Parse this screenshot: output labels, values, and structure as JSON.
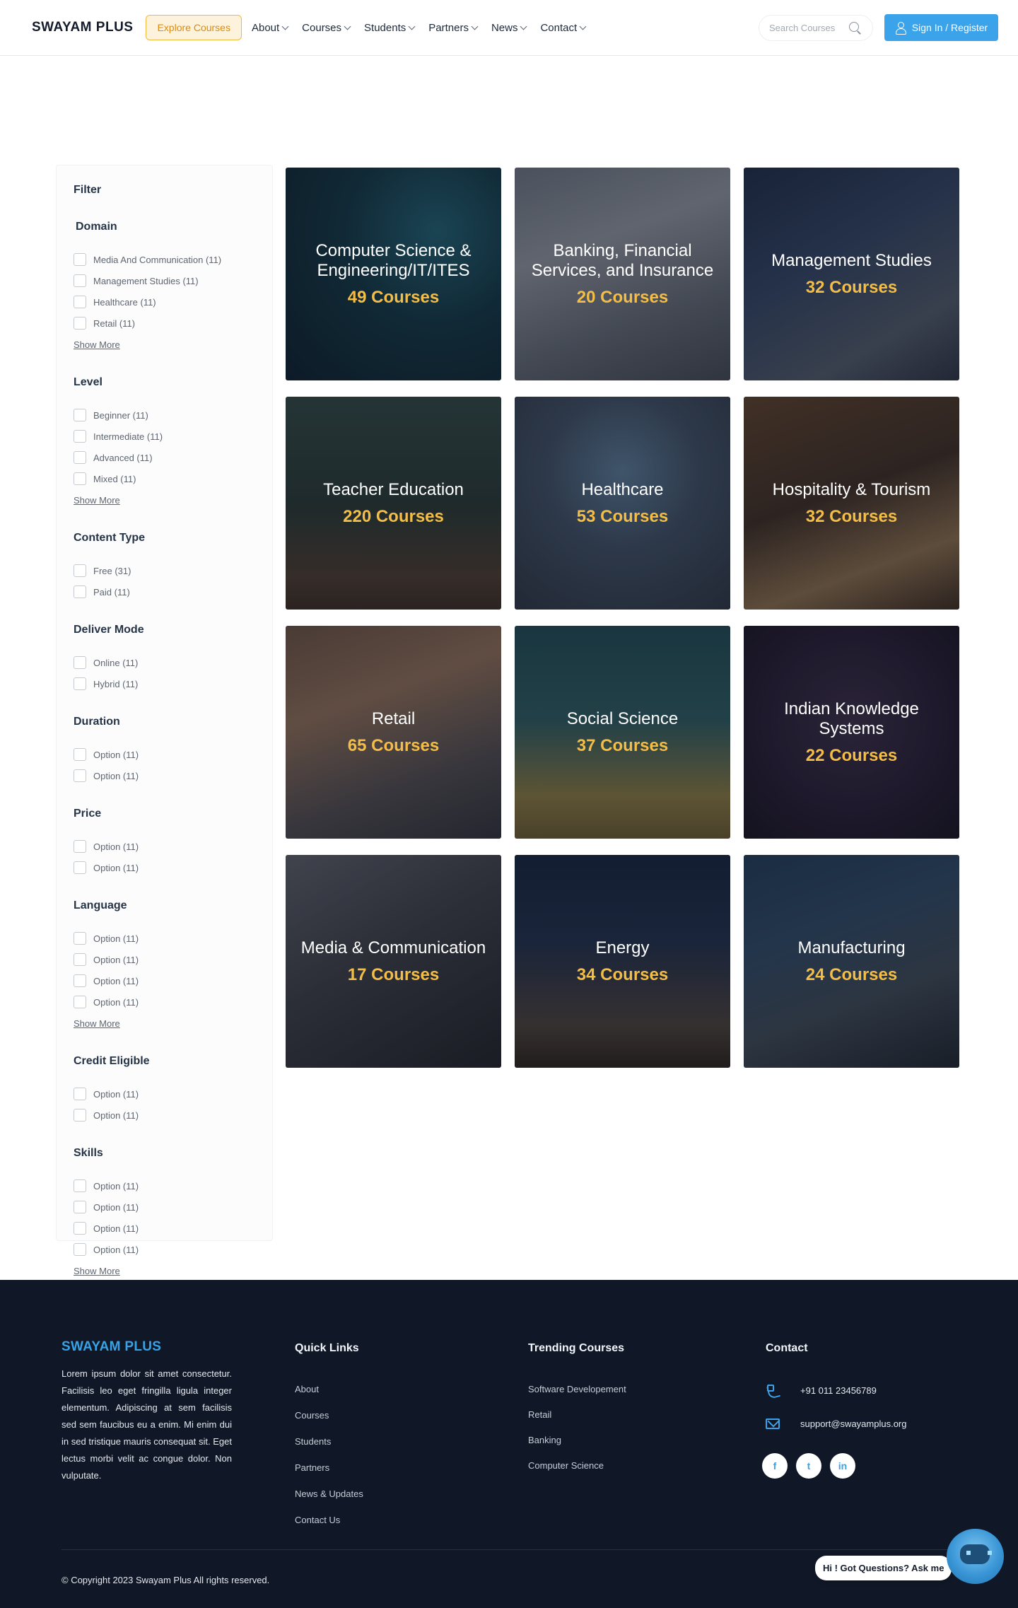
{
  "header": {
    "logo": "SWAYAM PLUS",
    "explore_label": "Explore Courses",
    "nav": [
      {
        "label": "About"
      },
      {
        "label": "Courses"
      },
      {
        "label": "Students"
      },
      {
        "label": "Partners"
      },
      {
        "label": "News"
      },
      {
        "label": "Contact"
      }
    ],
    "search_placeholder": "Search Courses",
    "signin_label": "Sign In / Register"
  },
  "filter": {
    "title": "Filter",
    "groups": [
      {
        "title": "Domain",
        "options": [
          "Media And Communication (11)",
          "Management Studies (11)",
          "Healthcare (11)",
          "Retail (11)"
        ],
        "show_more": "Show More"
      },
      {
        "title": "Level",
        "options": [
          "Beginner (11)",
          "Intermediate (11)",
          "Advanced (11)",
          "Mixed (11)"
        ],
        "show_more": "Show More"
      },
      {
        "title": "Content Type",
        "options": [
          "Free (31)",
          "Paid (11)"
        ]
      },
      {
        "title": "Deliver Mode",
        "options": [
          "Online (11)",
          "Hybrid (11)"
        ]
      },
      {
        "title": "Duration",
        "options": [
          "Option (11)",
          "Option (11)"
        ]
      },
      {
        "title": "Price",
        "options": [
          "Option (11)",
          "Option (11)"
        ]
      },
      {
        "title": "Language",
        "options": [
          "Option (11)",
          "Option (11)",
          "Option (11)",
          "Option (11)"
        ],
        "show_more": "Show More"
      },
      {
        "title": "Credit Eligible",
        "options": [
          "Option (11)",
          "Option (11)"
        ]
      },
      {
        "title": "Skills",
        "options": [
          "Option (11)",
          "Option (11)",
          "Option (11)",
          "Option (11)"
        ],
        "show_more": "Show More"
      }
    ]
  },
  "categories": [
    {
      "title": "Computer Science & Engineering/IT/ITES",
      "count": "49 Courses"
    },
    {
      "title": "Banking, Financial Services, and Insurance",
      "count": "20 Courses"
    },
    {
      "title": "Management Studies",
      "count": "32 Courses"
    },
    {
      "title": "Teacher  Education",
      "count": "220 Courses"
    },
    {
      "title": "Healthcare",
      "count": "53 Courses"
    },
    {
      "title": "Hospitality & Tourism",
      "count": "32 Courses"
    },
    {
      "title": "Retail",
      "count": "65 Courses"
    },
    {
      "title": "Social Science",
      "count": "37 Courses"
    },
    {
      "title": "Indian Knowledge Systems",
      "count": "22 Courses"
    },
    {
      "title": "Media & Communication",
      "count": "17 Courses"
    },
    {
      "title": "Energy",
      "count": "34  Courses"
    },
    {
      "title": "Manufacturing",
      "count": "24 Courses"
    }
  ],
  "footer": {
    "logo": "SWAYAM PLUS",
    "description": "Lorem ipsum dolor sit amet consectetur. Facilisis leo eget fringilla ligula integer elementum. Adipiscing at sem facilisis sed sem faucibus eu a enim. Mi enim dui in sed tristique mauris consequat sit. Eget lectus morbi velit ac congue dolor. Non vulputate.",
    "quick_links_title": "Quick Links",
    "quick_links": [
      "About",
      "Courses",
      "Students",
      "Partners",
      "News & Updates",
      "Contact Us"
    ],
    "trending_title": "Trending Courses",
    "trending": [
      "Software Developement",
      "Retail",
      "Banking",
      "Computer Science"
    ],
    "contact_title": "Contact",
    "phone": "+91 011 23456789",
    "email": "support@swayamplus.org",
    "social": [
      {
        "icon": "facebook-icon",
        "glyph": "f"
      },
      {
        "icon": "twitter-icon",
        "glyph": "t"
      },
      {
        "icon": "linkedin-icon",
        "glyph": "in"
      }
    ],
    "copyright": "© Copyright 2023  Swayam Plus  All rights reserved."
  },
  "chat": {
    "prompt": "Hi ! Got Questions? Ask me"
  },
  "colors": {
    "accent": "#3aa3ea",
    "highlight": "#f4bd46",
    "footer_bg": "#101828"
  }
}
